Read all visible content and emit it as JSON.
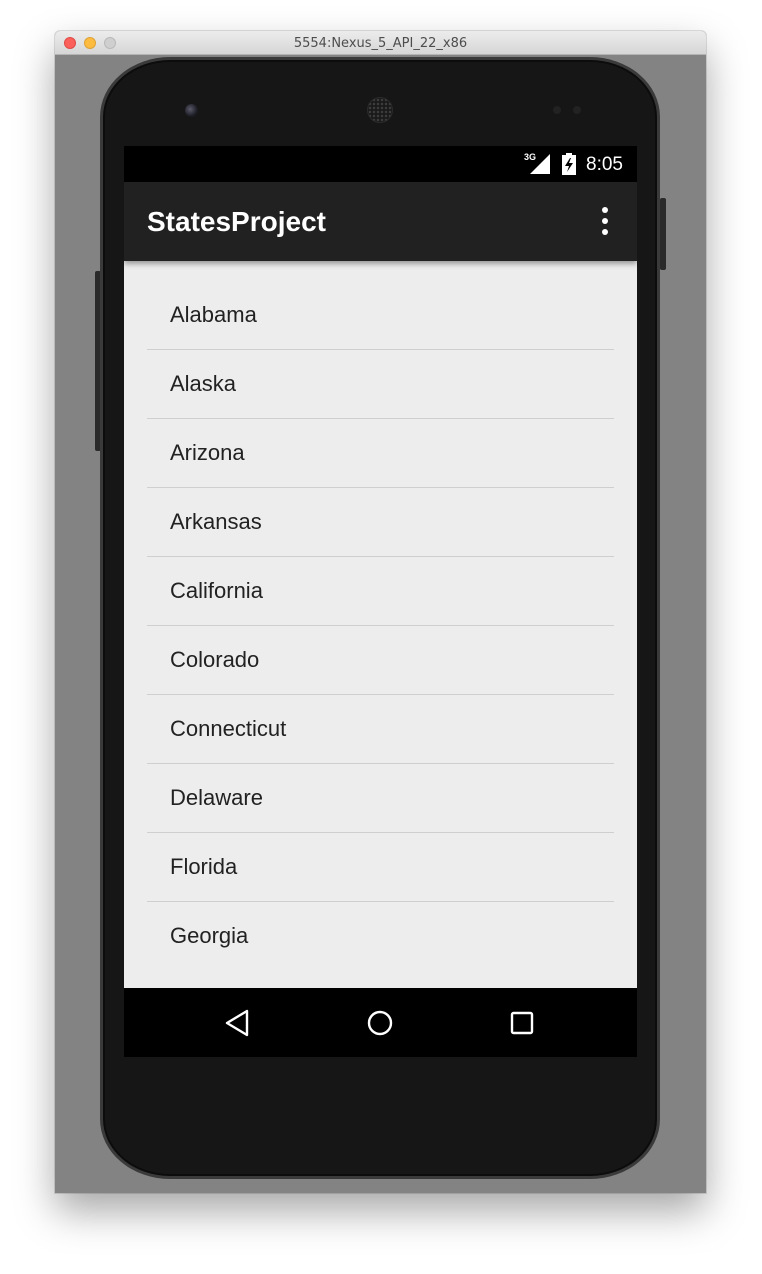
{
  "window": {
    "title": "5554:Nexus_5_API_22_x86"
  },
  "status_bar": {
    "network": "3G",
    "signal_icon": "cell-signal-icon",
    "battery_icon": "battery-charging-icon",
    "time": "8:05"
  },
  "app_bar": {
    "title": "StatesProject",
    "overflow_icon": "more-vert-icon"
  },
  "list": {
    "items": [
      {
        "label": "Alabama"
      },
      {
        "label": "Alaska"
      },
      {
        "label": "Arizona"
      },
      {
        "label": "Arkansas"
      },
      {
        "label": "California"
      },
      {
        "label": "Colorado"
      },
      {
        "label": "Connecticut"
      },
      {
        "label": "Delaware"
      },
      {
        "label": "Florida"
      },
      {
        "label": "Georgia"
      }
    ]
  },
  "nav_bar": {
    "back_icon": "back-triangle-icon",
    "home_icon": "home-circle-icon",
    "recent_icon": "recent-apps-square-icon"
  },
  "colors": {
    "app_bar": "#212121",
    "list_background": "#ededed",
    "divider": "#cfcfcf",
    "emulator_background": "#838383"
  }
}
